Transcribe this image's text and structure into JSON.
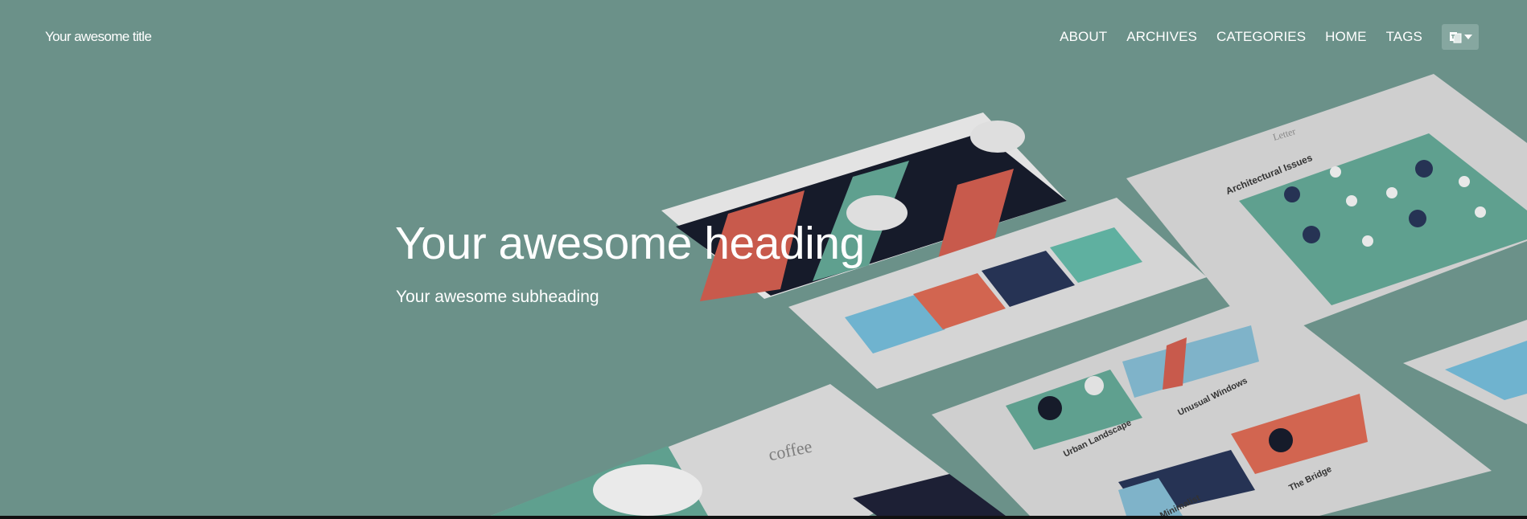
{
  "brand": {
    "title": "Your awesome title"
  },
  "nav": {
    "items": [
      {
        "label": "ABOUT"
      },
      {
        "label": "ARCHIVES"
      },
      {
        "label": "CATEGORIES"
      },
      {
        "label": "HOME"
      },
      {
        "label": "TAGS"
      }
    ],
    "language_icon": "translate-icon",
    "dropdown_icon": "caret-down-icon"
  },
  "hero": {
    "heading": "Your awesome heading",
    "subheading": "Your awesome subheading",
    "background_color": "#6b9189"
  },
  "mockups": {
    "card_coffee": {
      "title": "coffee"
    },
    "card_grid": {
      "items": [
        {
          "title": "Urban Landscape"
        },
        {
          "title": "Unusual Windows"
        },
        {
          "title": "Minimalist"
        },
        {
          "title": "The Bridge"
        }
      ]
    },
    "card_letter": {
      "logo": "Letter",
      "title": "Architectural Issues"
    }
  }
}
